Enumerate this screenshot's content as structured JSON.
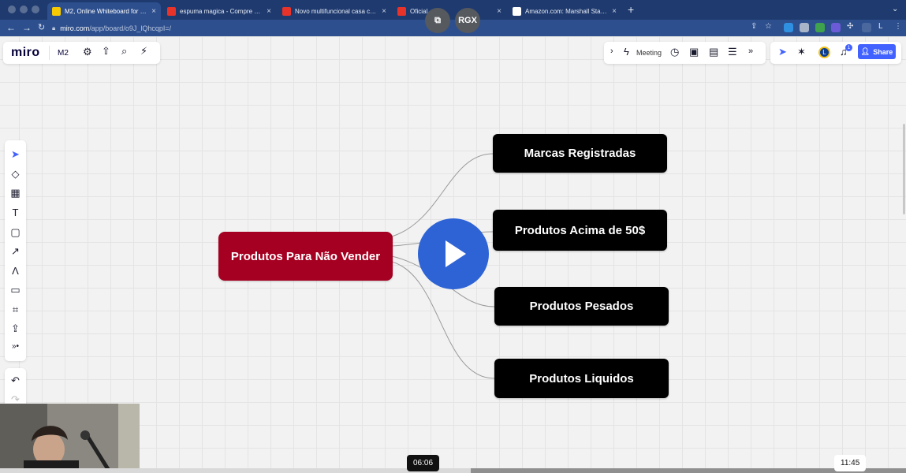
{
  "browser": {
    "tabs": [
      {
        "title": "M2, Online Whiteboard for Vi...",
        "active": true,
        "favicon_color": "#f7c900"
      },
      {
        "title": "espuma magica - Compre esp...",
        "active": false,
        "favicon_color": "#e8332b"
      },
      {
        "title": "Novo multifuncional casa cozi...",
        "active": false,
        "favicon_color": "#e8332b"
      },
      {
        "title": "Oficial",
        "active": false,
        "favicon_color": "#e8332b"
      },
      {
        "title": "Amazon.com: Marshall Stanm...",
        "active": false,
        "favicon_color": "#ffffff"
      }
    ],
    "close_glyph": "×",
    "new_tab_glyph": "+",
    "url_host": "miro.com",
    "url_path": "/app/board/o9J_lQhcqpI=/"
  },
  "video_overlay": {
    "pip_label": "⧉",
    "rgx_label": "RGX",
    "current_time": "06:06",
    "duration": "11:45",
    "progress_fraction": 0.52
  },
  "toolbar": {
    "logo": "miro",
    "board_name": "M2",
    "meeting_label": "Meeting",
    "share_label": "Share",
    "avatar_initial": "L",
    "notification_count": "1",
    "collapse_glyph": "›",
    "more_glyph": "»"
  },
  "mindmap": {
    "root": "Produtos Para Não Vender",
    "children": [
      "Marcas Registradas",
      "Produtos Acima de 50$",
      "Produtos Pesados",
      "Produtos Liquidos"
    ],
    "root_color": "#a50021",
    "child_color": "#000000"
  },
  "colors": {
    "browser_chrome": "#1f3a6e",
    "miro_accent": "#4262ff",
    "play_button": "#2e63d6"
  }
}
